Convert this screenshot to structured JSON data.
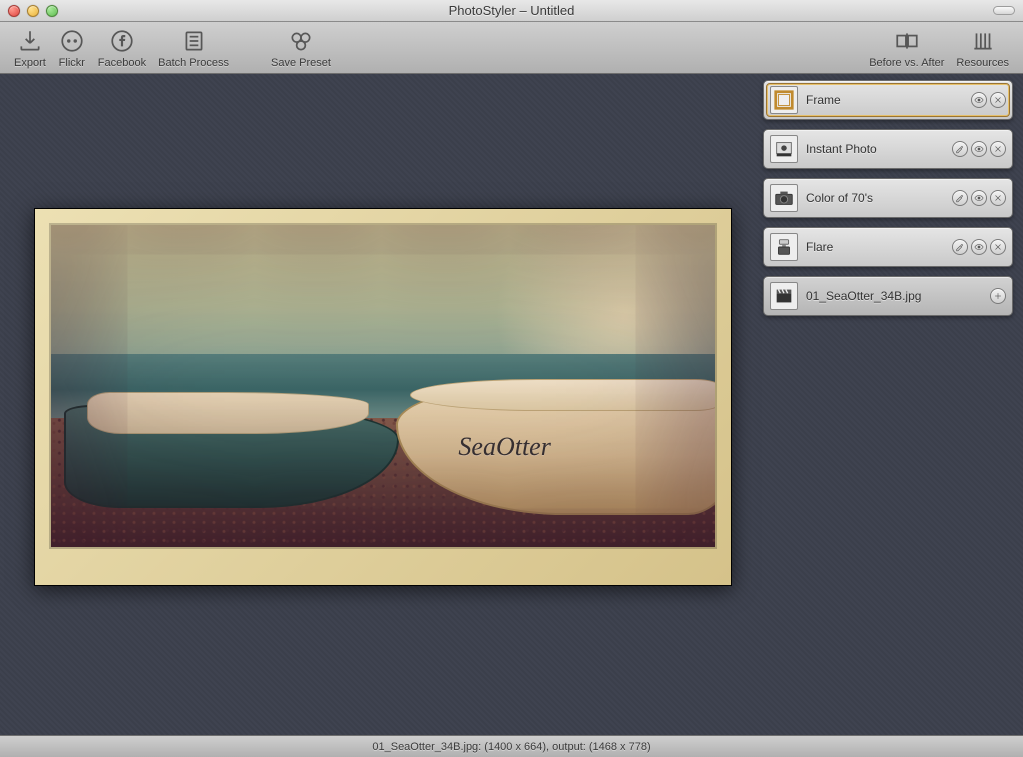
{
  "window": {
    "title": "PhotoStyler – Untitled"
  },
  "toolbar": {
    "export": "Export",
    "flickr": "Flickr",
    "facebook": "Facebook",
    "batch": "Batch Process",
    "save_preset": "Save Preset",
    "before_after": "Before vs. After",
    "resources": "Resources"
  },
  "canvas": {
    "boat_name": "SeaOtter"
  },
  "layers": [
    {
      "id": "frame",
      "label": "Frame",
      "has_adjust": false,
      "selected": true
    },
    {
      "id": "instant-photo",
      "label": "Instant Photo",
      "has_adjust": true,
      "selected": false
    },
    {
      "id": "color-70s",
      "label": "Color of 70's",
      "has_adjust": true,
      "selected": false
    },
    {
      "id": "flare",
      "label": "Flare",
      "has_adjust": true,
      "selected": false
    }
  ],
  "source": {
    "filename": "01_SeaOtter_34B.jpg"
  },
  "status": {
    "text": "01_SeaOtter_34B.jpg: (1400 x 664), output: (1468 x 778)"
  }
}
